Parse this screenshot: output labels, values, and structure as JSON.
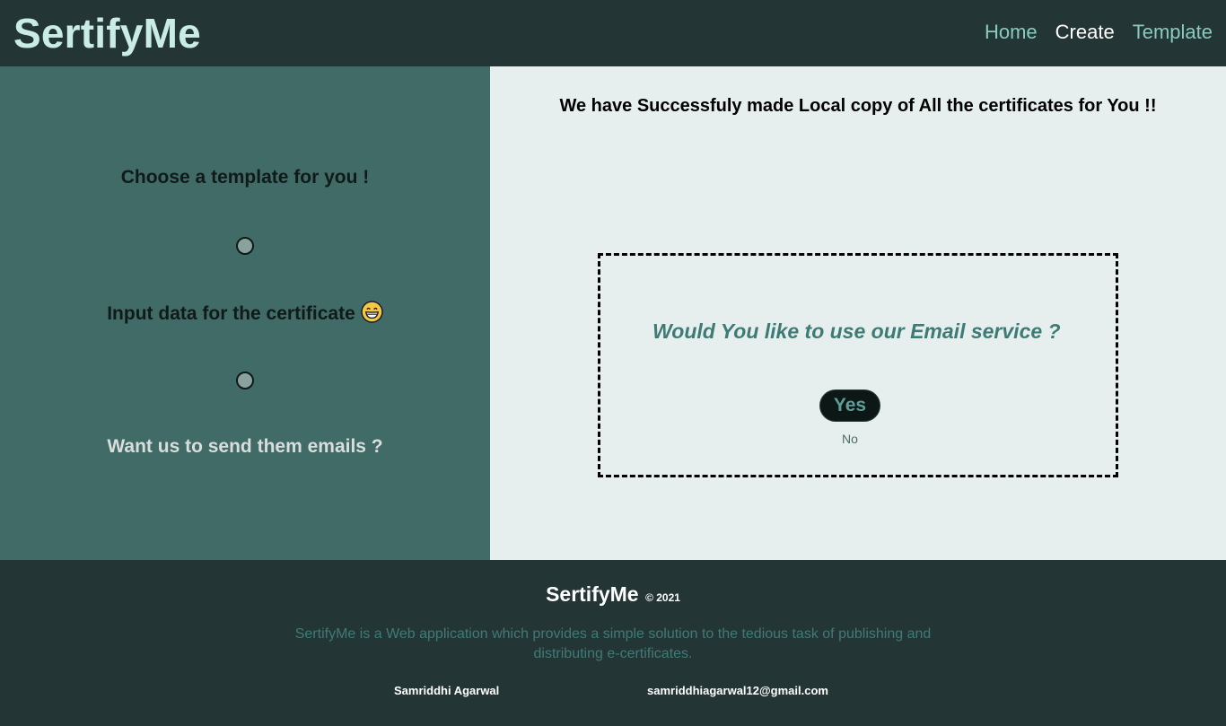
{
  "header": {
    "brand": "SertifyMe",
    "nav": [
      {
        "label": "Home"
      },
      {
        "label": "Create"
      },
      {
        "label": "Template"
      }
    ],
    "active_nav": "Create"
  },
  "left_panel": {
    "steps": [
      {
        "label": "Choose a template for you !"
      },
      {
        "label": "Input data for the certificate",
        "icon": "grinning-face-emoji"
      },
      {
        "label": "Want us to send them emails ?"
      }
    ]
  },
  "main": {
    "success_message": "We have Successfuly made Local copy of All the certificates for You !!",
    "email_prompt": {
      "question": "Would You like to use our Email service ?",
      "yes_label": "Yes",
      "no_label": "No"
    }
  },
  "footer": {
    "brand": "SertifyMe",
    "copyright": "© 2021",
    "description": "SertifyMe is a Web application which provides a simple solution to the tedious task of publishing and distributing e-certificates.",
    "author": "Samriddhi Agarwal",
    "email": "samriddhiagarwal12@gmail.com"
  },
  "colors": {
    "header_bg": "#243535",
    "brand": "#c9ece6",
    "nav_link": "#89cbbf",
    "nav_active": "#ffffff",
    "left_panel_bg": "#416b67",
    "right_panel_bg": "#e6efee",
    "accent_teal": "#3f7b76",
    "button_bg": "#0c1716"
  }
}
